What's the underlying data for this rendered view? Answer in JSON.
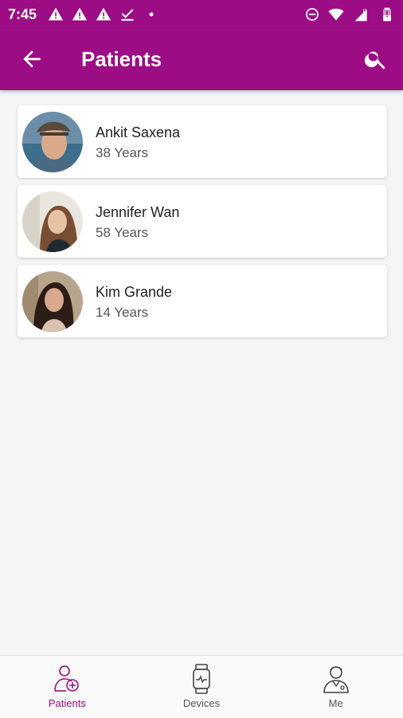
{
  "status_bar": {
    "time": "7:45",
    "icons_left": [
      "warning-icon",
      "warning-icon",
      "warning-icon",
      "download-done-icon",
      "dot-icon"
    ],
    "icons_right": [
      "do-not-disturb-icon",
      "wifi-icon",
      "signal-icon",
      "battery-icon"
    ],
    "signal_roaming_label": "R"
  },
  "app_bar": {
    "title": "Patients",
    "color": "#9c0c84"
  },
  "patients": [
    {
      "name": "Ankit Saxena",
      "age": "38 Years"
    },
    {
      "name": "Jennifer Wan",
      "age": "58 Years"
    },
    {
      "name": "Kim Grande",
      "age": "14 Years"
    }
  ],
  "bottom_nav": {
    "items": [
      {
        "label": "Patients",
        "icon": "patient-icon",
        "active": true
      },
      {
        "label": "Devices",
        "icon": "smartwatch-icon",
        "active": false
      },
      {
        "label": "Me",
        "icon": "doctor-icon",
        "active": false
      }
    ]
  }
}
